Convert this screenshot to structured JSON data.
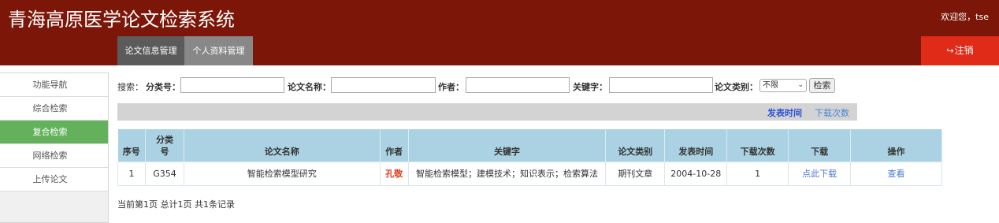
{
  "app": {
    "title": "青海高原医学论文检索系统",
    "welcome": "欢迎您，tse",
    "logout_label": "注销"
  },
  "tabs": [
    {
      "label": "论文信息管理"
    },
    {
      "label": "个人资料管理"
    }
  ],
  "sidebar": {
    "items": [
      {
        "label": "功能导航"
      },
      {
        "label": "综合检索"
      },
      {
        "label": "复合检索",
        "active": true
      },
      {
        "label": "网络检索"
      },
      {
        "label": "上传论文"
      }
    ]
  },
  "search": {
    "prefix": "搜索：",
    "category_no_label": "分类号：",
    "category_no_value": "",
    "title_label": "论文名称：",
    "title_value": "",
    "author_label": "作者：",
    "author_value": "",
    "keyword_label": "关键字：",
    "keyword_value": "",
    "type_label": "论文类别：",
    "type_selected": "不限",
    "button_label": "检索"
  },
  "sort": {
    "by_time": "发表时间",
    "by_downloads": "下载次数"
  },
  "table": {
    "headers": [
      "序号",
      "分类号",
      "论文名称",
      "作者",
      "关键字",
      "论文类别",
      "发表时间",
      "下载次数",
      "下载",
      "操作"
    ],
    "rows": [
      {
        "index": "1",
        "category_no": "G354",
        "title": "智能检索模型研究",
        "author": "孔敬",
        "keywords": "智能检索模型；建模技术；知识表示；检索算法",
        "type": "期刊文章",
        "date": "2004-10-28",
        "downloads": "1",
        "download_link": "点此下载",
        "action_link": "查看"
      }
    ]
  },
  "pager": {
    "text": "当前第1页 总计1页 共1条记录"
  },
  "colors": {
    "header_bg": "#7b1608",
    "logout_bg": "#e02b18",
    "active_nav": "#63b25b",
    "table_header_bg": "#abd2e2",
    "author_text": "#e03a1c",
    "link_text": "#4a79d6"
  }
}
